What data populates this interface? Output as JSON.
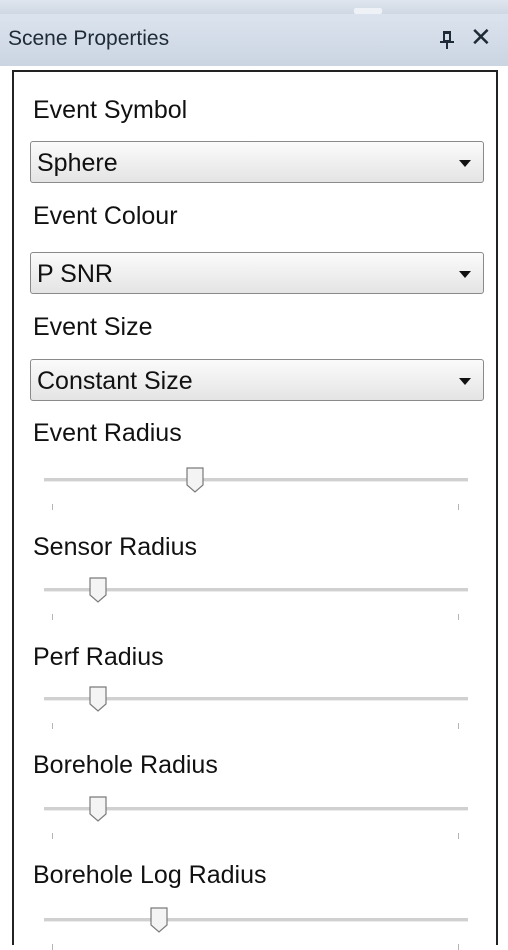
{
  "panel": {
    "title": "Scene Properties",
    "pin_glyph": "ᵖ",
    "close_glyph": "✕"
  },
  "event_symbol": {
    "label": "Event Symbol",
    "value": "Sphere"
  },
  "event_colour": {
    "label": "Event Colour",
    "value": "P SNR"
  },
  "event_size": {
    "label": "Event Size",
    "value": "Constant Size"
  },
  "sliders": {
    "event_radius": {
      "label": "Event Radius",
      "fraction": 0.35
    },
    "sensor_radius": {
      "label": "Sensor Radius",
      "fraction": 0.11
    },
    "perf_radius": {
      "label": "Perf Radius",
      "fraction": 0.11
    },
    "borehole_radius": {
      "label": "Borehole Radius",
      "fraction": 0.11
    },
    "borehole_log_radius": {
      "label": "Borehole Log Radius",
      "fraction": 0.26
    }
  },
  "colors": {
    "titlebar": "#cfd8e3",
    "text": "#111111",
    "panel_border": "#222222"
  },
  "icons": {
    "pin": "pin-icon",
    "close": "close-icon",
    "dropdown": "chevron-down-icon"
  }
}
